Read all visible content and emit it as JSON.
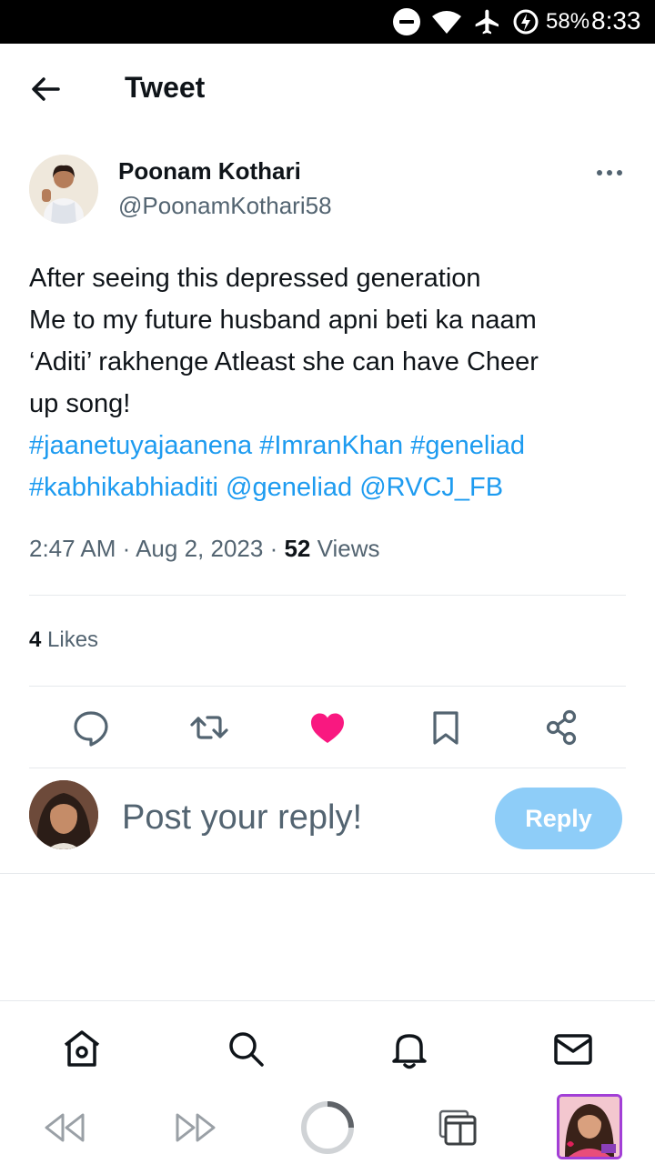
{
  "status_bar": {
    "battery": "58%",
    "time": "8:33",
    "icons": [
      "dnd-icon",
      "wifi-icon",
      "airplane-icon",
      "battery-saver-icon"
    ]
  },
  "header": {
    "title": "Tweet"
  },
  "tweet": {
    "author_name": "Poonam Kothari",
    "author_handle": "@PoonamKothari58",
    "text_lines": [
      "After seeing this depressed generation",
      "Me to my future husband apni beti ka naam",
      "‘Aditi’ rakhenge Atleast she can have Cheer",
      "up song!"
    ],
    "links_line1": [
      "#jaanetuyajaanena",
      "#ImranKhan",
      "#geneliad"
    ],
    "links_line2": [
      "#kabhikabhiaditi",
      "@geneliad",
      "@RVCJ_FB"
    ],
    "time": "2:47 AM",
    "date": "Aug 2, 2023",
    "views_count": "52",
    "views_label": "Views",
    "likes_count": "4",
    "likes_label": "Likes",
    "liked": true
  },
  "reply": {
    "placeholder": "Post your reply!",
    "button_label": "Reply"
  },
  "colors": {
    "link": "#1d9bf0",
    "like": "#f91880",
    "reply_button": "#8ecdf8",
    "secondary_text": "#536471"
  },
  "bottom_nav": [
    "home-icon",
    "search-icon",
    "notifications-icon",
    "messages-icon"
  ],
  "browser_toolbar": [
    "back-icon",
    "forward-icon",
    "loading-icon",
    "tabs-icon",
    "tab-thumbnail"
  ]
}
